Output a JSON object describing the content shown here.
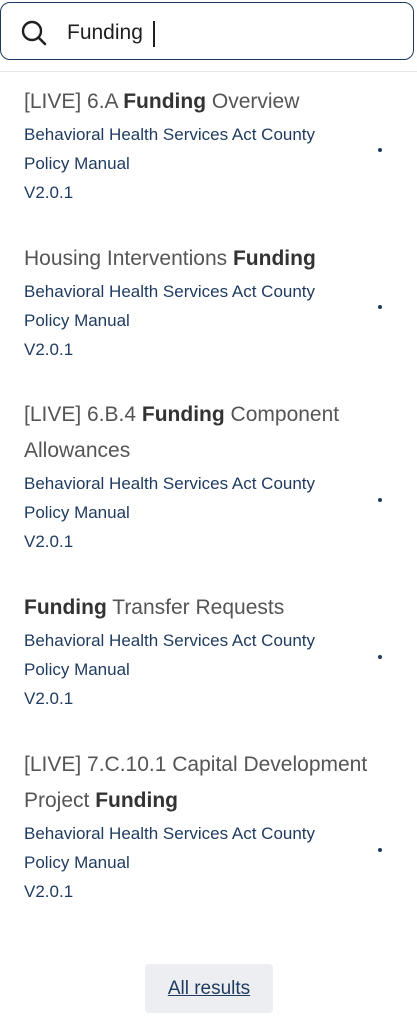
{
  "search": {
    "value": "Funding",
    "icon": "search-icon"
  },
  "results": [
    {
      "title_pre": "[LIVE] 6.A ",
      "title_match": "Funding",
      "title_post": " Overview",
      "source": "Behavioral Health Services Act County Policy Manual",
      "version": "V2.0.1"
    },
    {
      "title_pre": "Housing Interventions ",
      "title_match": "Funding",
      "title_post": "",
      "source": "Behavioral Health Services Act County Policy Manual",
      "version": "V2.0.1"
    },
    {
      "title_pre": "[LIVE] 6.B.4 ",
      "title_match": "Funding",
      "title_post": " Component Allowances",
      "source": "Behavioral Health Services Act County Policy Manual",
      "version": "V2.0.1"
    },
    {
      "title_pre": "",
      "title_match": "Funding",
      "title_post": " Transfer Requests",
      "source": "Behavioral Health Services Act County Policy Manual",
      "version": "V2.0.1"
    },
    {
      "title_pre": "[LIVE] 7.C.10.1 Capital Development Project ",
      "title_match": "Funding",
      "title_post": "",
      "source": "Behavioral Health Services Act County Policy Manual",
      "version": "V2.0.1"
    }
  ],
  "footer": {
    "all_results_label": "All results"
  },
  "colors": {
    "accent": "#1e3a5f",
    "title_text": "#555555",
    "button_bg": "#eceef2"
  }
}
